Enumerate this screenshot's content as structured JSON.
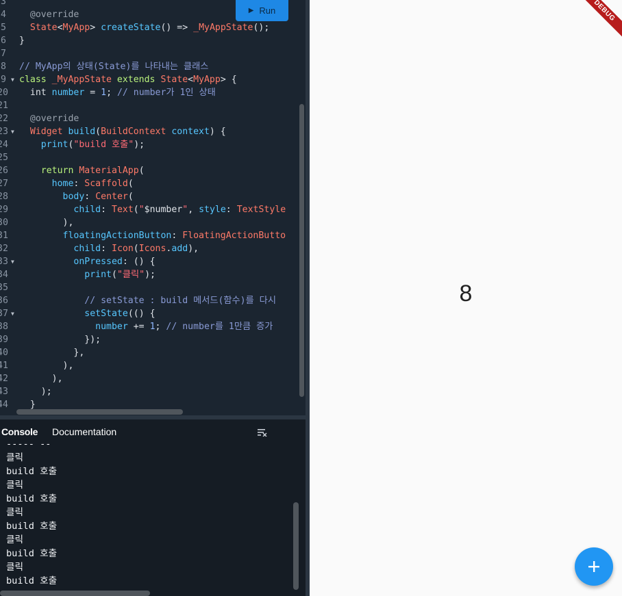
{
  "toolbar": {
    "run_label": "Run"
  },
  "editor": {
    "lines": [
      {
        "n": "3",
        "fold": false,
        "segs": []
      },
      {
        "n": "4",
        "fold": false,
        "segs": [
          [
            "  ",
            "plain"
          ],
          [
            "@override",
            "ann"
          ]
        ]
      },
      {
        "n": "5",
        "fold": false,
        "segs": [
          [
            "  ",
            "plain"
          ],
          [
            "State",
            "type"
          ],
          [
            "<",
            "plain"
          ],
          [
            "MyApp",
            "type"
          ],
          [
            "> ",
            "plain"
          ],
          [
            "createState",
            "fn"
          ],
          [
            "() => ",
            "plain"
          ],
          [
            "_MyAppState",
            "type"
          ],
          [
            "();",
            "plain"
          ]
        ]
      },
      {
        "n": "6",
        "fold": false,
        "segs": [
          [
            "}",
            "plain"
          ]
        ]
      },
      {
        "n": "7",
        "fold": false,
        "segs": []
      },
      {
        "n": "8",
        "fold": false,
        "segs": [
          [
            "// MyApp의 상태(State)를 나타내는 클래스",
            "cmt"
          ]
        ]
      },
      {
        "n": "9",
        "fold": true,
        "segs": [
          [
            "class ",
            "kw"
          ],
          [
            "_MyAppState ",
            "type"
          ],
          [
            "extends ",
            "kw"
          ],
          [
            "State",
            "type"
          ],
          [
            "<",
            "plain"
          ],
          [
            "MyApp",
            "type"
          ],
          [
            "> {",
            "plain"
          ]
        ]
      },
      {
        "n": "20",
        "fold": false,
        "segs": [
          [
            "  ",
            "plain"
          ],
          [
            "int ",
            "plain"
          ],
          [
            "number",
            "fn"
          ],
          [
            " = ",
            "plain"
          ],
          [
            "1",
            "num"
          ],
          [
            "; ",
            "plain"
          ],
          [
            "// number가 1인 상태",
            "cmt"
          ]
        ]
      },
      {
        "n": "21",
        "fold": false,
        "segs": []
      },
      {
        "n": "22",
        "fold": false,
        "segs": [
          [
            "  ",
            "plain"
          ],
          [
            "@override",
            "ann"
          ]
        ]
      },
      {
        "n": "23",
        "fold": true,
        "segs": [
          [
            "  ",
            "plain"
          ],
          [
            "Widget ",
            "type"
          ],
          [
            "build",
            "fn"
          ],
          [
            "(",
            "plain"
          ],
          [
            "BuildContext ",
            "type"
          ],
          [
            "context",
            "fn"
          ],
          [
            ") {",
            "plain"
          ]
        ]
      },
      {
        "n": "24",
        "fold": false,
        "segs": [
          [
            "    ",
            "plain"
          ],
          [
            "print",
            "fn"
          ],
          [
            "(",
            "plain"
          ],
          [
            "\"build 호출\"",
            "str"
          ],
          [
            ");",
            "plain"
          ]
        ]
      },
      {
        "n": "25",
        "fold": false,
        "segs": []
      },
      {
        "n": "26",
        "fold": false,
        "segs": [
          [
            "    ",
            "plain"
          ],
          [
            "return ",
            "kw"
          ],
          [
            "MaterialApp",
            "type"
          ],
          [
            "(",
            "plain"
          ]
        ]
      },
      {
        "n": "27",
        "fold": false,
        "segs": [
          [
            "      ",
            "plain"
          ],
          [
            "home",
            "fn"
          ],
          [
            ": ",
            "plain"
          ],
          [
            "Scaffold",
            "type"
          ],
          [
            "(",
            "plain"
          ]
        ]
      },
      {
        "n": "28",
        "fold": false,
        "segs": [
          [
            "        ",
            "plain"
          ],
          [
            "body",
            "fn"
          ],
          [
            ": ",
            "plain"
          ],
          [
            "Center",
            "type"
          ],
          [
            "(",
            "plain"
          ]
        ]
      },
      {
        "n": "29",
        "fold": false,
        "segs": [
          [
            "          ",
            "plain"
          ],
          [
            "child",
            "fn"
          ],
          [
            ": ",
            "plain"
          ],
          [
            "Text",
            "type"
          ],
          [
            "(",
            "plain"
          ],
          [
            "\"",
            "str"
          ],
          [
            "$number",
            "plain"
          ],
          [
            "\"",
            "str"
          ],
          [
            ", ",
            "plain"
          ],
          [
            "style",
            "fn"
          ],
          [
            ": ",
            "plain"
          ],
          [
            "TextStyle",
            "type"
          ]
        ]
      },
      {
        "n": "30",
        "fold": false,
        "segs": [
          [
            "        ",
            "plain"
          ],
          [
            "),",
            "plain"
          ]
        ]
      },
      {
        "n": "31",
        "fold": false,
        "segs": [
          [
            "        ",
            "plain"
          ],
          [
            "floatingActionButton",
            "fn"
          ],
          [
            ": ",
            "plain"
          ],
          [
            "FloatingActionButto",
            "type"
          ]
        ]
      },
      {
        "n": "32",
        "fold": false,
        "segs": [
          [
            "          ",
            "plain"
          ],
          [
            "child",
            "fn"
          ],
          [
            ": ",
            "plain"
          ],
          [
            "Icon",
            "type"
          ],
          [
            "(",
            "plain"
          ],
          [
            "Icons",
            "type"
          ],
          [
            ".",
            "plain"
          ],
          [
            "add",
            "fn"
          ],
          [
            "),",
            "plain"
          ]
        ]
      },
      {
        "n": "33",
        "fold": true,
        "segs": [
          [
            "          ",
            "plain"
          ],
          [
            "onPressed",
            "fn"
          ],
          [
            ": () {",
            "plain"
          ]
        ]
      },
      {
        "n": "34",
        "fold": false,
        "segs": [
          [
            "            ",
            "plain"
          ],
          [
            "print",
            "fn"
          ],
          [
            "(",
            "plain"
          ],
          [
            "\"클릭\"",
            "str"
          ],
          [
            ");",
            "plain"
          ]
        ]
      },
      {
        "n": "35",
        "fold": false,
        "segs": []
      },
      {
        "n": "36",
        "fold": false,
        "segs": [
          [
            "            ",
            "plain"
          ],
          [
            "// setState : build 메서드(함수)를 다시",
            "cmt"
          ]
        ]
      },
      {
        "n": "37",
        "fold": true,
        "segs": [
          [
            "            ",
            "plain"
          ],
          [
            "setState",
            "fn"
          ],
          [
            "(() {",
            "plain"
          ]
        ]
      },
      {
        "n": "38",
        "fold": false,
        "segs": [
          [
            "              ",
            "plain"
          ],
          [
            "number",
            "fn"
          ],
          [
            " += ",
            "plain"
          ],
          [
            "1",
            "num"
          ],
          [
            "; ",
            "plain"
          ],
          [
            "// number를 1만큼 증가",
            "cmt"
          ]
        ]
      },
      {
        "n": "39",
        "fold": false,
        "segs": [
          [
            "            ",
            "plain"
          ],
          [
            "});",
            "plain"
          ]
        ]
      },
      {
        "n": "40",
        "fold": false,
        "segs": [
          [
            "          ",
            "plain"
          ],
          [
            "},",
            "plain"
          ]
        ]
      },
      {
        "n": "41",
        "fold": false,
        "segs": [
          [
            "        ",
            "plain"
          ],
          [
            "),",
            "plain"
          ]
        ]
      },
      {
        "n": "42",
        "fold": false,
        "segs": [
          [
            "      ",
            "plain"
          ],
          [
            "),",
            "plain"
          ]
        ]
      },
      {
        "n": "43",
        "fold": false,
        "segs": [
          [
            "    ",
            "plain"
          ],
          [
            ");",
            "plain"
          ]
        ]
      },
      {
        "n": "44",
        "fold": false,
        "segs": [
          [
            "  ",
            "plain"
          ],
          [
            "}",
            "plain"
          ]
        ]
      }
    ]
  },
  "console": {
    "tabs": [
      {
        "label": "Console"
      },
      {
        "label": "Documentation"
      }
    ],
    "lines": [
      "----- --",
      "클릭",
      "build 호출",
      "클릭",
      "build 호출",
      "클릭",
      "build 호출",
      "클릭",
      "build 호출",
      "클릭",
      "build 호출"
    ]
  },
  "preview": {
    "counter_value": "8",
    "debug_banner": "DEBUG",
    "fab_icon": "plus-icon"
  },
  "colors": {
    "editor_bg": "#1b2530",
    "console_bg": "#151c24",
    "accent": "#1e88e5",
    "fab": "#2196f3",
    "debug_banner": "#b71c1c"
  }
}
